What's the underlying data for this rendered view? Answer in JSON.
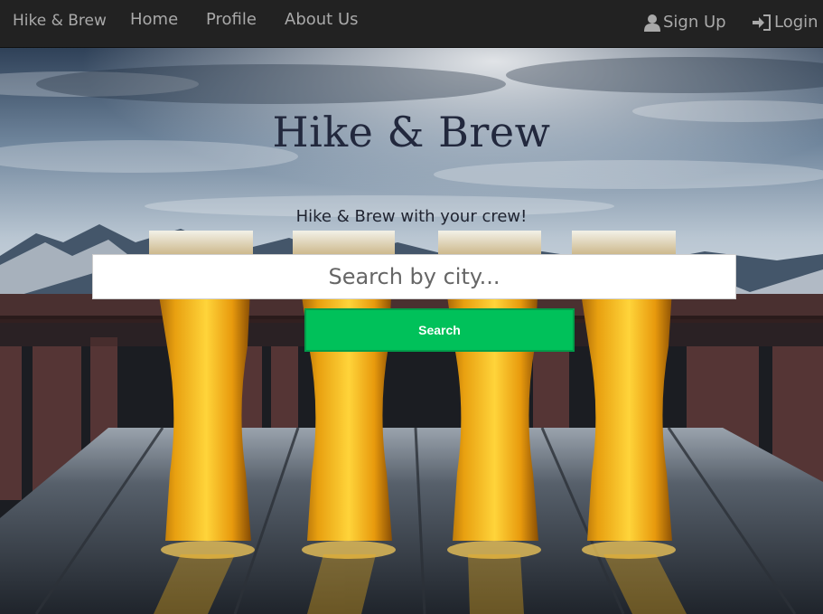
{
  "nav": {
    "brand": "Hike & Brew",
    "links": [
      "Home",
      "Profile",
      "About Us"
    ],
    "signup_label": "Sign Up",
    "login_label": "Login"
  },
  "hero": {
    "title": "Hike & Brew",
    "tagline": "Hike & Brew with your crew!",
    "background": "beer glasses on a wooden table with snowy mountains and cloudy sky"
  },
  "search": {
    "placeholder": "Search by city...",
    "value": "",
    "button_label": "Search"
  },
  "colors": {
    "navbar": "#222222",
    "nav_text": "#a9a9a9",
    "search_button": "#00c15a",
    "title": "#22283d"
  }
}
